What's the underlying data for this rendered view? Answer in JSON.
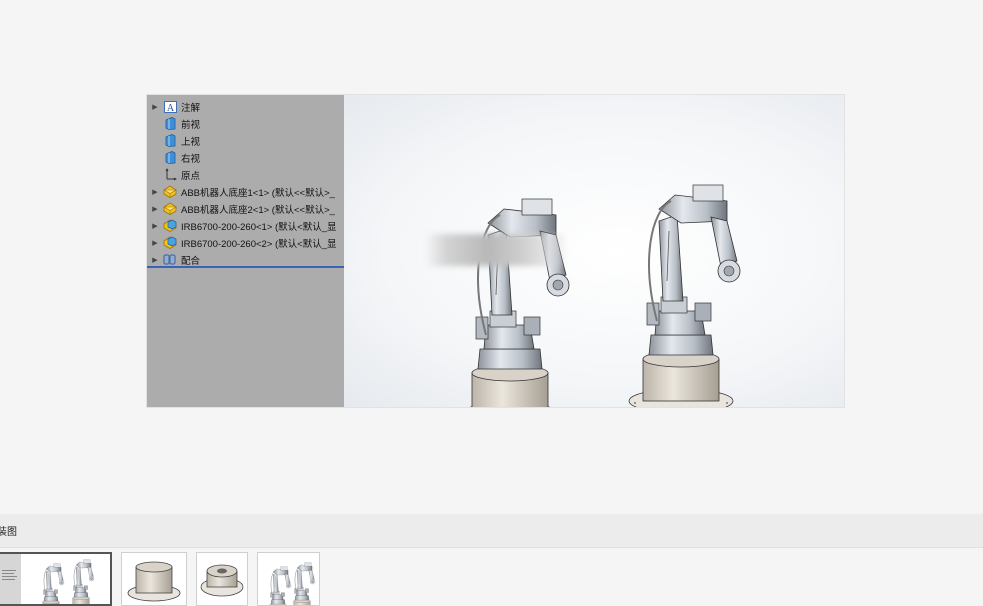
{
  "feature_tree": {
    "items": [
      {
        "label": "注解",
        "expandable": true,
        "icon": "annotations-icon"
      },
      {
        "label": "前视",
        "expandable": false,
        "icon": "plane-icon"
      },
      {
        "label": "上视",
        "expandable": false,
        "icon": "plane-icon"
      },
      {
        "label": "右视",
        "expandable": false,
        "icon": "plane-icon"
      },
      {
        "label": "原点",
        "expandable": false,
        "icon": "origin-icon"
      },
      {
        "label": "ABB机器人底座1<1> (默认<<默认>_",
        "expandable": true,
        "icon": "part-icon"
      },
      {
        "label": "ABB机器人底座2<1> (默认<<默认>_",
        "expandable": true,
        "icon": "part-icon"
      },
      {
        "label": "IRB6700-200-260<1> (默认<默认_显",
        "expandable": true,
        "icon": "subassembly-icon"
      },
      {
        "label": "IRB6700-200-260<2> (默认<默认_显",
        "expandable": true,
        "icon": "subassembly-icon"
      },
      {
        "label": "配合",
        "expandable": true,
        "icon": "mates-icon"
      }
    ]
  },
  "tab_strip": {
    "label": "装图"
  },
  "thumbnails": [
    {
      "name": "assembly-view",
      "active": true
    },
    {
      "name": "base-1",
      "active": false
    },
    {
      "name": "base-2",
      "active": false
    },
    {
      "name": "robot-arm",
      "active": false
    }
  ],
  "colors": {
    "tree_bg": "#acacac",
    "accent": "#3a62b8",
    "part_yellow": "#f2c21b",
    "plane_blue": "#3f8fd6"
  }
}
